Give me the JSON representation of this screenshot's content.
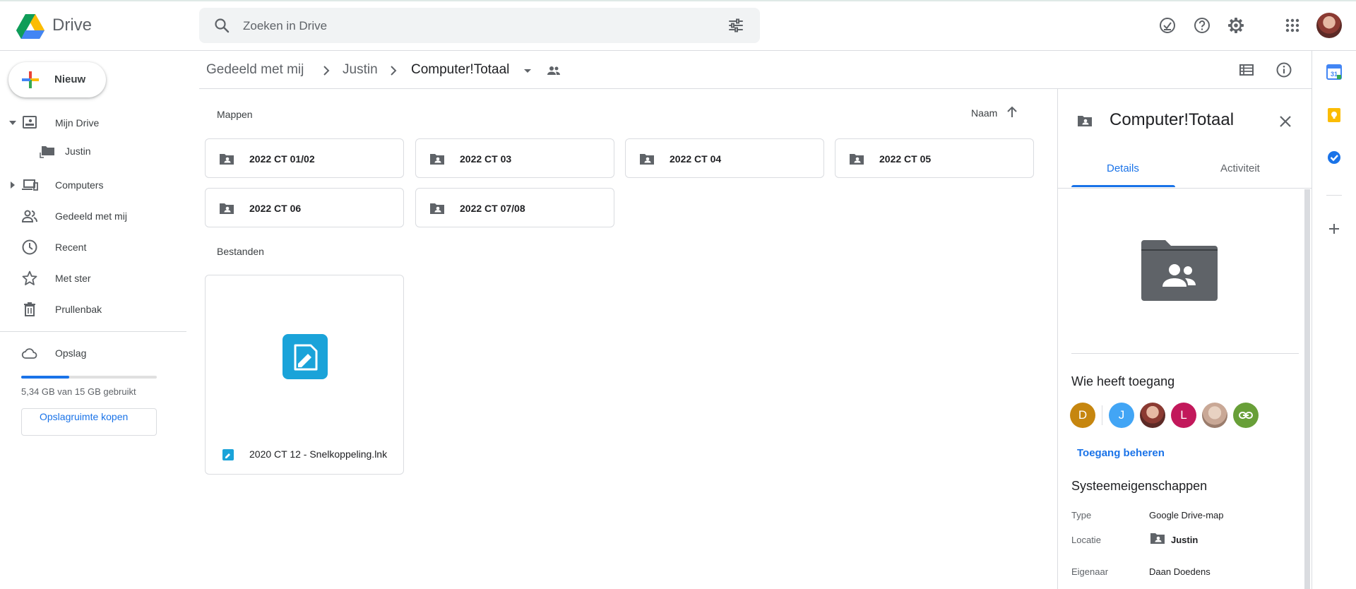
{
  "app": {
    "name": "Drive"
  },
  "search": {
    "placeholder": "Zoeken in Drive"
  },
  "sidebar": {
    "new_label": "Nieuw",
    "items": [
      {
        "label": "Mijn Drive"
      },
      {
        "label": "Justin"
      },
      {
        "label": "Computers"
      },
      {
        "label": "Gedeeld met mij"
      },
      {
        "label": "Recent"
      },
      {
        "label": "Met ster"
      },
      {
        "label": "Prullenbak"
      },
      {
        "label": "Opslag"
      }
    ],
    "storage": {
      "text": "5,34 GB van 15 GB gebruikt",
      "used_fraction": 0.356,
      "buy_label": "Opslagruimte kopen"
    }
  },
  "breadcrumb": [
    "Gedeeld met mij",
    "Justin",
    "Computer!Totaal"
  ],
  "main": {
    "folders_title": "Mappen",
    "files_title": "Bestanden",
    "sort_label": "Naam",
    "folders": [
      "2022 CT 01/02",
      "2022 CT 03",
      "2022 CT 04",
      "2022 CT 05",
      "2022 CT 06",
      "2022 CT 07/08"
    ],
    "files": [
      {
        "name": "2020 CT 12 - Snelkoppeling.lnk"
      }
    ]
  },
  "details": {
    "title": "Computer!Totaal",
    "tabs": [
      "Details",
      "Activiteit"
    ],
    "access_title": "Wie heeft toegang",
    "avatars": [
      {
        "letter": "D",
        "color": "#c6860f"
      },
      {
        "letter": "J",
        "color": "#42a5f5"
      },
      {
        "letter": "",
        "color": "#8b3a32"
      },
      {
        "letter": "L",
        "color": "#c2185b"
      },
      {
        "letter": "",
        "color": "#c9a896"
      },
      {
        "letter": "",
        "color": "#689f38"
      }
    ],
    "manage_label": "Toegang beheren",
    "system_title": "Systeemeigenschappen",
    "props": {
      "type_label": "Type",
      "type_value": "Google Drive-map",
      "location_label": "Locatie",
      "location_value": "Justin",
      "owner_label": "Eigenaar",
      "owner_value": "Daan Doedens"
    }
  },
  "colors": {
    "accent": "#1a73e8",
    "icon_gray": "#5f6368",
    "border": "#dadce0",
    "shortcut_blue": "#1aa3d9"
  }
}
